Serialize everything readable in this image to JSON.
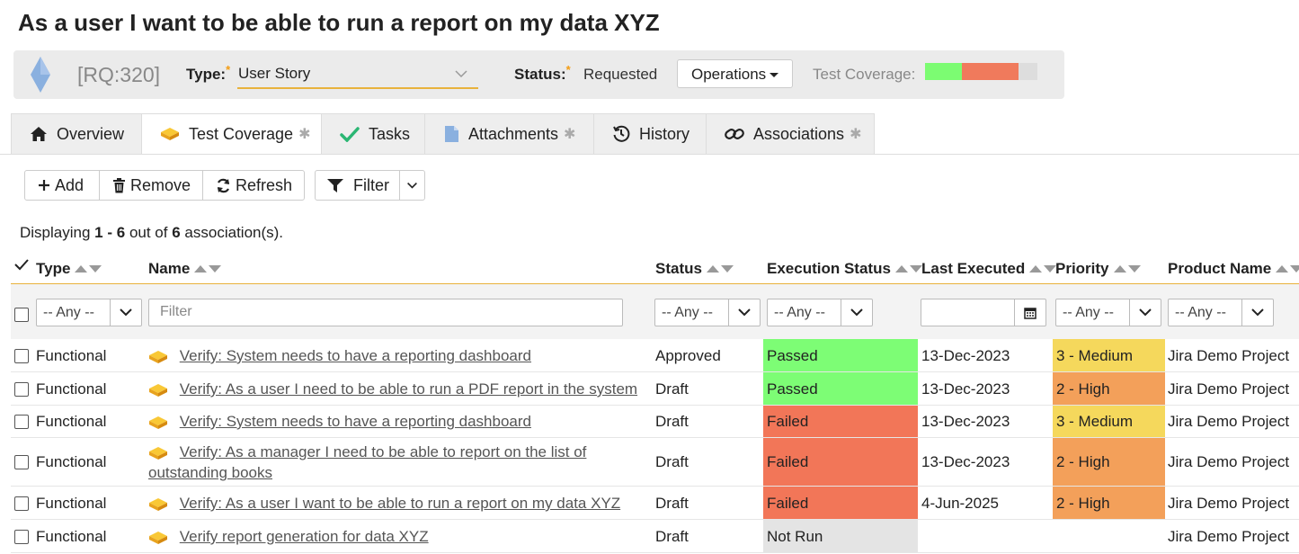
{
  "page": {
    "title": "As a user I want to be able to run a report on my data XYZ"
  },
  "infobar": {
    "id": "[RQ:320]",
    "type_label": "Type:",
    "type_value": "User Story",
    "status_label": "Status:",
    "status_value": "Requested",
    "operations_label": "Operations",
    "test_coverage_label": "Test Coverage:",
    "coverage": {
      "passed_fraction": 0.33,
      "failed_fraction": 0.5,
      "not_run_fraction": 0.17,
      "colors": {
        "passed": "#7cfc72",
        "failed": "#f07a5c",
        "not_run": "#dddddd"
      }
    }
  },
  "tabs": [
    {
      "label": "Overview",
      "icon": "home-icon",
      "dirty": ""
    },
    {
      "label": "Test Coverage",
      "icon": "test-case-icon",
      "dirty": "✱"
    },
    {
      "label": "Tasks",
      "icon": "check-icon",
      "dirty": ""
    },
    {
      "label": "Attachments",
      "icon": "document-icon",
      "dirty": "✱"
    },
    {
      "label": "History",
      "icon": "history-icon",
      "dirty": ""
    },
    {
      "label": "Associations",
      "icon": "link-icon",
      "dirty": "✱"
    }
  ],
  "toolbar": {
    "add": "Add",
    "remove": "Remove",
    "refresh": "Refresh",
    "filter": "Filter"
  },
  "display": {
    "prefix": "Displaying",
    "range": "1 - 6",
    "middle": "out of",
    "total": "6",
    "suffix": "association(s)."
  },
  "columns": {
    "type": "Type",
    "name": "Name",
    "status": "Status",
    "execution_status": "Execution Status",
    "last_executed": "Last Executed",
    "priority": "Priority",
    "product_name": "Product Name"
  },
  "filters": {
    "any": "-- Any --",
    "name_placeholder": "Filter"
  },
  "rows": [
    {
      "type": "Functional",
      "name": "Verify: System needs to have a reporting dashboard",
      "name2": "",
      "status": "Approved",
      "execution_status": "Passed",
      "last_executed": "13-Dec-2023",
      "priority": "3 - Medium",
      "product": "Jira Demo Project"
    },
    {
      "type": "Functional",
      "name": "Verify: As a user I need to be able to run a PDF report in the system",
      "name2": "",
      "status": "Draft",
      "execution_status": "Passed",
      "last_executed": "13-Dec-2023",
      "priority": "2 - High",
      "product": "Jira Demo Project"
    },
    {
      "type": "Functional",
      "name": "Verify: System needs to have a reporting dashboard",
      "name2": "",
      "status": "Draft",
      "execution_status": "Failed",
      "last_executed": "13-Dec-2023",
      "priority": "3 - Medium",
      "product": "Jira Demo Project"
    },
    {
      "type": "Functional",
      "name": "Verify: As a manager I need to be able to report on the list of",
      "name2": "outstanding books",
      "status": "Draft",
      "execution_status": "Failed",
      "last_executed": "13-Dec-2023",
      "priority": "2 - High",
      "product": "Jira Demo Project"
    },
    {
      "type": "Functional",
      "name": "Verify: As a user I want to be able to run a report on my data XYZ",
      "name2": "",
      "status": "Draft",
      "execution_status": "Failed",
      "last_executed": "4-Jun-2025",
      "priority": "2 - High",
      "product": "Jira Demo Project"
    },
    {
      "type": "Functional",
      "name": "Verify report generation for data XYZ",
      "name2": "",
      "status": "Draft",
      "execution_status": "Not Run",
      "last_executed": "",
      "priority": "",
      "product": "Jira Demo Project"
    }
  ],
  "colors": {
    "passed": "#7dfd75",
    "failed": "#f27658",
    "not_run": "#e4e4e4",
    "medium": "#f5d85c",
    "high": "#f3a05a",
    "accent": "#e8b23c"
  }
}
